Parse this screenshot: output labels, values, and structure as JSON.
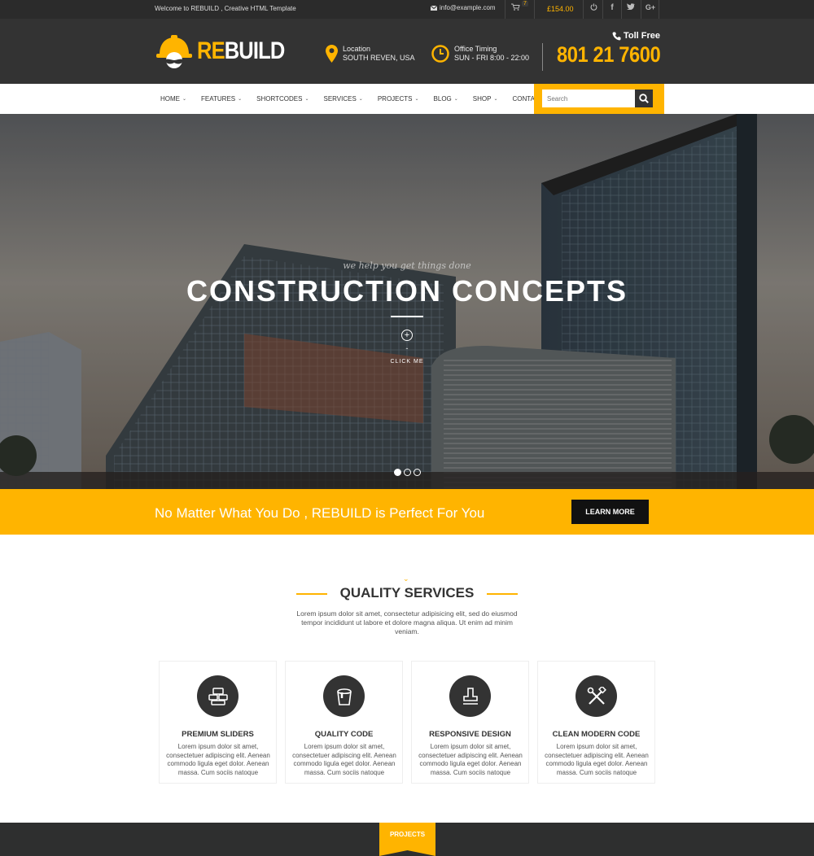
{
  "topbar": {
    "welcome": "Welcome to REBUILD , Creative HTML Template",
    "email": "info@example.com",
    "cart_count": "7",
    "cart_total": "£154.00",
    "icons": [
      "power-icon",
      "facebook-icon",
      "twitter-icon",
      "google-plus-icon"
    ]
  },
  "header": {
    "logo_re": "RE",
    "logo_build": "BUILD",
    "location_label": "Location",
    "location_value": "SOUTH REVEN, USA",
    "timing_label": "Office Timing",
    "timing_value": "SUN - FRI 8:00 - 22:00",
    "toll_free_label": "Toll Free",
    "phone": "801 21 7600"
  },
  "nav": {
    "items": [
      {
        "label": "HOME"
      },
      {
        "label": "FEATURES"
      },
      {
        "label": "SHORTCODES"
      },
      {
        "label": "SERVICES"
      },
      {
        "label": "PROJECTS"
      },
      {
        "label": "BLOG"
      },
      {
        "label": "SHOP"
      },
      {
        "label": "CONTACT US"
      }
    ],
    "search_placeholder": "Search"
  },
  "hero": {
    "tagline": "we help you get things done",
    "title": "CONSTRUCTION CONCEPTS",
    "click_me": "CLICK ME",
    "slides": 3,
    "active_slide": 1
  },
  "banner": {
    "text": "No Matter What You Do , REBUILD is Perfect For You",
    "button": "LEARN MORE"
  },
  "services": {
    "title": "QUALITY SERVICES",
    "description": "Lorem ipsum dolor sit amet, consectetur adipisicing elit, sed do eiusmod tempor incididunt ut labore et dolore magna aliqua. Ut enim ad minim veniam.",
    "cards": [
      {
        "title": "PREMIUM SLIDERS",
        "icon": "sliders-icon",
        "text": "Lorem ipsum dolor sit amet, consectetuer adipiscing elit. Aenean commodo ligula eget dolor. Aenean massa. Cum sociis natoque"
      },
      {
        "title": "QUALITY CODE",
        "icon": "paint-bucket-icon",
        "text": "Lorem ipsum dolor sit amet, consectetuer adipiscing elit. Aenean commodo ligula eget dolor. Aenean massa. Cum sociis natoque"
      },
      {
        "title": "RESPONSIVE DESIGN",
        "icon": "stamp-icon",
        "text": "Lorem ipsum dolor sit amet, consectetuer adipiscing elit. Aenean commodo ligula eget dolor. Aenean massa. Cum sociis natoque"
      },
      {
        "title": "CLEAN MODERN CODE",
        "icon": "tools-icon",
        "text": "Lorem ipsum dolor sit amet, consectetuer adipiscing elit. Aenean commodo ligula eget dolor. Aenean massa. Cum sociis natoque"
      }
    ]
  },
  "projects": {
    "tab": "PROJECTS"
  },
  "colors": {
    "accent": "#ffb400",
    "dark": "#333333",
    "topbar": "#2b2b2b"
  }
}
